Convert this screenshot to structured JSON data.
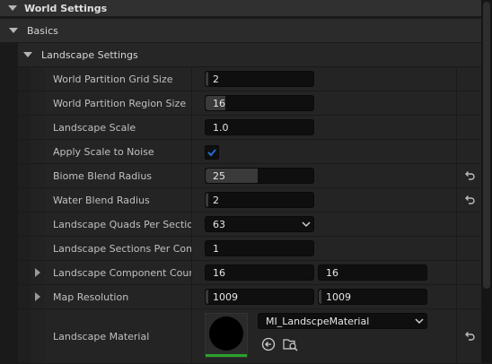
{
  "world_settings": {
    "title": "World Settings"
  },
  "basics": {
    "title": "Basics"
  },
  "landscape_settings": {
    "title": "Landscape Settings"
  },
  "properties": [
    {
      "label": "World Partition Grid Size",
      "value": "2",
      "fill": 0.02
    },
    {
      "label": "World Partition Region Size",
      "value": "16",
      "fill": 0.18
    },
    {
      "label": "Landscape Scale",
      "value": "1.0",
      "fill": 0
    },
    {
      "label": "Apply Scale to Noise",
      "checked": true
    },
    {
      "label": "Biome Blend Radius",
      "value": "25",
      "fill": 0.48
    },
    {
      "label": "Water Blend Radius",
      "value": "2",
      "fill": 0.02
    },
    {
      "label": "Landscape Quads Per Section",
      "value": "63"
    },
    {
      "label": "Landscape Sections Per Com...",
      "value": "1"
    },
    {
      "label": "Landscape Component Count",
      "value_x": "16",
      "value_y": "16"
    },
    {
      "label": "Map Resolution",
      "value_x": "1009",
      "value_y": "1009"
    },
    {
      "label": "Landscape Material",
      "asset": "MI_LandscpeMaterial"
    }
  ],
  "colors": {
    "accent": "#1f6fd1",
    "thumbnail_bar": "#2aa32a"
  },
  "icons": {
    "collapse": "chevron-down-icon",
    "expand": "chevron-right-icon",
    "reset": "reset-to-default-icon",
    "use_selected": "use-selected-asset-icon",
    "browse": "browse-asset-icon"
  }
}
